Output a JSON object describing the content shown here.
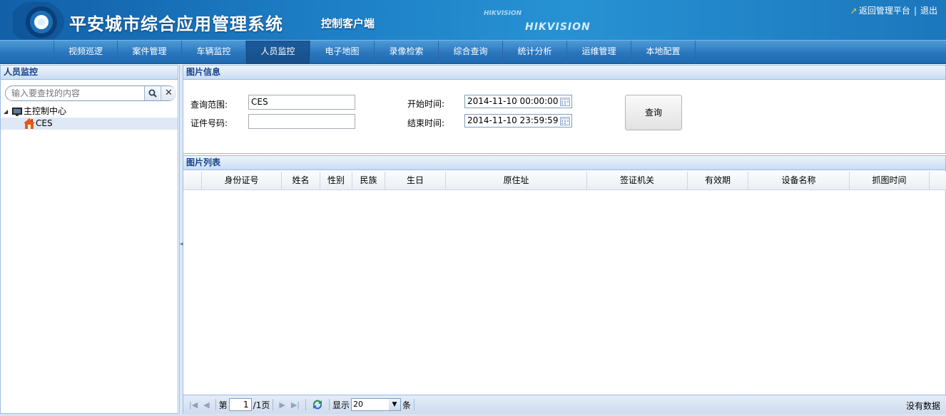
{
  "header": {
    "title": "平安城市综合应用管理系统",
    "subtitle": "控制客户端",
    "brand": "HIKVISION",
    "brand_small": "HIKVISION",
    "return_link": "返回管理平台",
    "separator": "|",
    "logout_link": "退出"
  },
  "nav": {
    "items": [
      "视频巡逻",
      "案件管理",
      "车辆监控",
      "人员监控",
      "电子地图",
      "录像检索",
      "综合查询",
      "统计分析",
      "运维管理",
      "本地配置"
    ],
    "active_index": 3
  },
  "left_panel": {
    "title": "人员监控",
    "search_placeholder": "输入要查找的内容",
    "tree": {
      "root": "主控制中心",
      "child": "CES"
    }
  },
  "info_panel": {
    "title": "图片信息",
    "scope_label": "查询范围:",
    "scope_value": "CES",
    "id_label": "证件号码:",
    "id_value": "",
    "start_label": "开始时间:",
    "start_value": "2014-11-10 00:00:00",
    "end_label": "结束时间:",
    "end_value": "2014-11-10 23:59:59",
    "query_button": "查询"
  },
  "list_panel": {
    "title": "图片列表",
    "columns": [
      "身份证号",
      "姓名",
      "性别",
      "民族",
      "生日",
      "原住址",
      "签证机关",
      "有效期",
      "设备名称",
      "抓图时间"
    ]
  },
  "pager": {
    "page_prefix": "第",
    "page_value": "1",
    "page_total": "/1页",
    "show_label": "显示",
    "page_size": "20",
    "unit": "条",
    "status": "没有数据"
  },
  "colors": {
    "header_blue": "#1d7fc6",
    "nav_active": "#184f88",
    "panel_title": "#15428b",
    "panel_border": "#99bbe8"
  }
}
